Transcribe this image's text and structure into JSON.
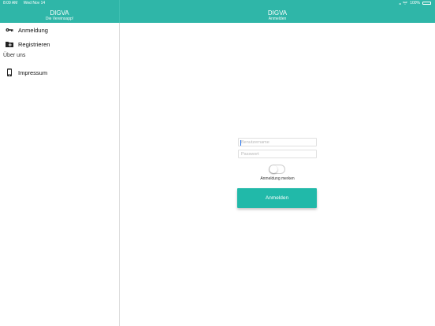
{
  "status": {
    "time": "8:09 AM",
    "date": "Wed Nov 14",
    "battery": "100%"
  },
  "sidebar_header": {
    "title": "DIGVA",
    "subtitle": "Die Vereinsapp!"
  },
  "main_header": {
    "title": "DIGVA",
    "subtitle": "Anmelden"
  },
  "menu": {
    "items": [
      {
        "label": "Anmeldung",
        "icon": "key-icon"
      },
      {
        "label": "Registrieren",
        "icon": "folder-add-icon"
      }
    ],
    "section_label": "Über uns",
    "about_items": [
      {
        "label": "Impressum",
        "icon": "phone-icon"
      }
    ]
  },
  "login": {
    "username_placeholder": "Benutzername",
    "password_placeholder": "Passwort",
    "remember_label": "Anmeldung merken",
    "remember_enabled": false,
    "submit_label": "Anmelden"
  },
  "colors": {
    "accent": "#2fb6a8",
    "button": "#21b9a9"
  }
}
